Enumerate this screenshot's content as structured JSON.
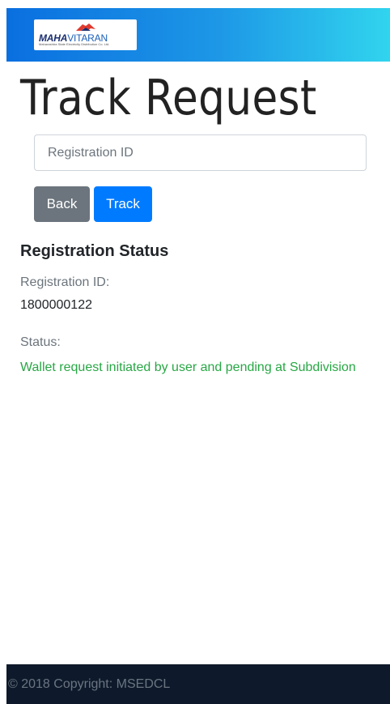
{
  "header": {
    "logo": {
      "brand_primary": "MAHA",
      "brand_secondary": "VITARAN",
      "tagline": "Maharashtra State Electricity Distribution Co. Ltd.",
      "colors": {
        "red": "#e03a2f",
        "navy": "#1b2f6e",
        "blue": "#1b5fb8"
      }
    },
    "gradient": [
      "#0a6fe0",
      "#31d4ee"
    ]
  },
  "page": {
    "title": "Track Request"
  },
  "form": {
    "registration_placeholder": "Registration ID",
    "registration_value": "",
    "back_label": "Back",
    "track_label": "Track"
  },
  "status_panel": {
    "heading": "Registration Status",
    "registration_id_label": "Registration ID:",
    "registration_id_value": "1800000122",
    "status_label": "Status:",
    "status_value": "Wallet request initiated by user and pending at Subdivision",
    "status_color": "#28a745"
  },
  "footer": {
    "copyright": "© 2018 Copyright: MSEDCL"
  }
}
